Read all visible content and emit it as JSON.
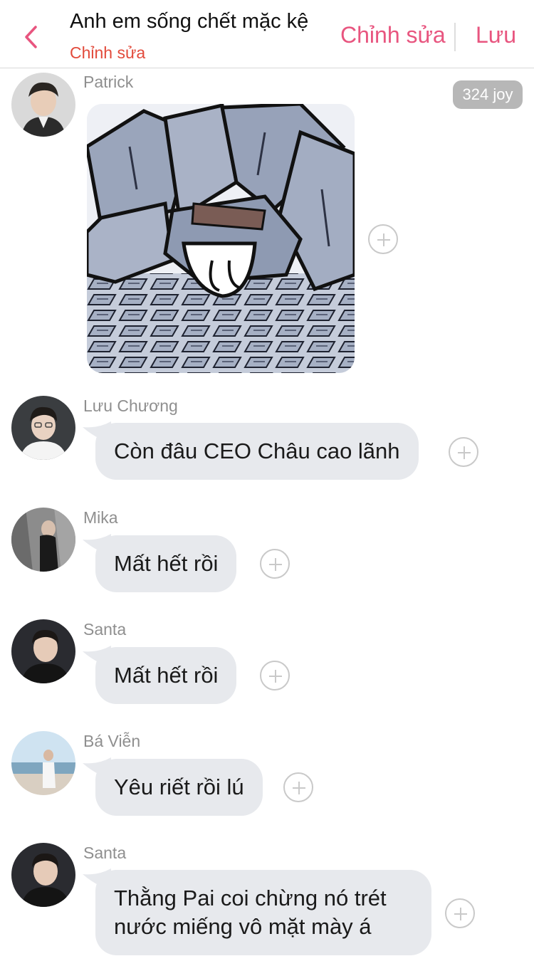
{
  "header": {
    "title": "Anh em sống chết mặc kệ",
    "subtitle": "Chỉnh sửa",
    "edit_label": "Chỉnh sửa",
    "save_label": "Lưu"
  },
  "colors": {
    "accent": "#e8557f",
    "subtitle": "#e24a3b",
    "bubble": "#e7e9ed",
    "sender": "#8f8f8f"
  },
  "messages": [
    {
      "sender": "Patrick",
      "type": "sticker",
      "badge": "324 joy"
    },
    {
      "sender": "Lưu Chương",
      "text": "Còn đâu CEO Châu cao lãnh"
    },
    {
      "sender": "Mika",
      "text": "Mất hết rồi"
    },
    {
      "sender": "Santa",
      "text": "Mất hết rồi"
    },
    {
      "sender": "Bá Viễn",
      "text": "Yêu riết rồi lú"
    },
    {
      "sender": "Santa",
      "text_lines": [
        "Thằng Pai coi chừng nó trét",
        "nước miếng vô mặt mày á"
      ]
    }
  ]
}
